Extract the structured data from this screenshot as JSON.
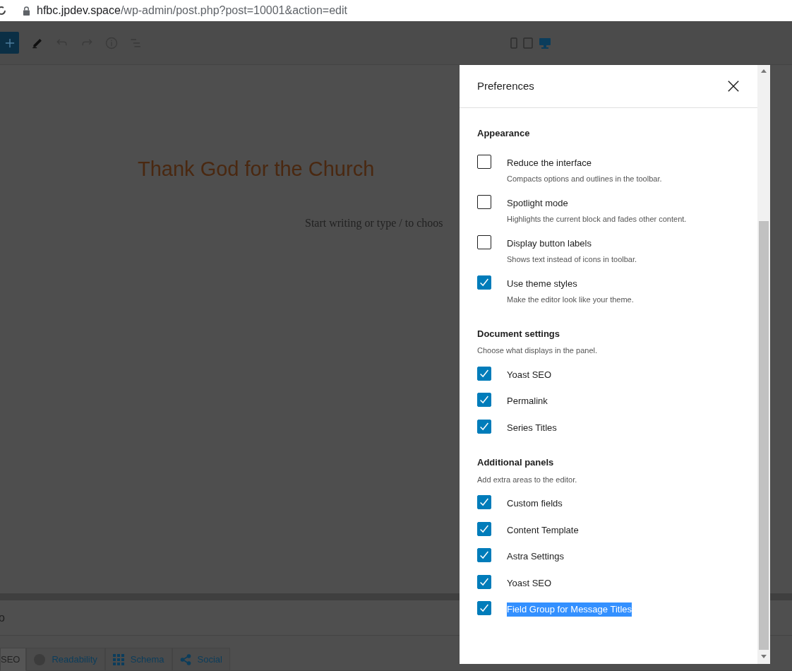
{
  "browser": {
    "url_host": "hfbc.jpdev.space",
    "url_path": "/wp-admin/post.php?post=10001&action=edit"
  },
  "device_previews": [
    {
      "kind": "mobile",
      "selected": false
    },
    {
      "kind": "tablet",
      "selected": false
    },
    {
      "kind": "desktop",
      "selected": true
    }
  ],
  "editor": {
    "title": "Thank God for the Church",
    "body_placeholder": "Start writing or type / to choos"
  },
  "yoast_panel": {
    "heading_fragment": "o",
    "tabs": [
      {
        "kind": "seo",
        "label": "SEO",
        "selected": true
      },
      {
        "kind": "readability",
        "label": "Readability",
        "selected": false
      },
      {
        "kind": "schema",
        "label": "Schema",
        "selected": false
      },
      {
        "kind": "social",
        "label": "Social",
        "selected": false
      }
    ]
  },
  "preferences": {
    "title": "Preferences",
    "sections": [
      {
        "heading": "Appearance",
        "options": [
          {
            "label": "Reduce the interface",
            "description": "Compacts options and outlines in the toolbar.",
            "checked": false
          },
          {
            "label": "Spotlight mode",
            "description": "Highlights the current block and fades other content.",
            "checked": false
          },
          {
            "label": "Display button labels",
            "description": "Shows text instead of icons in toolbar.",
            "checked": false
          },
          {
            "label": "Use theme styles",
            "description": "Make the editor look like your theme.",
            "checked": true
          }
        ]
      },
      {
        "heading": "Document settings",
        "description": "Choose what displays in the panel.",
        "options": [
          {
            "label": "Yoast SEO",
            "checked": true
          },
          {
            "label": "Permalink",
            "checked": true
          },
          {
            "label": "Series Titles",
            "checked": true
          }
        ]
      },
      {
        "heading": "Additional panels",
        "description": "Add extra areas to the editor.",
        "options": [
          {
            "label": "Custom fields",
            "checked": true
          },
          {
            "label": "Content Template",
            "checked": true
          },
          {
            "label": "Astra Settings",
            "checked": true
          },
          {
            "label": "Yoast SEO",
            "checked": true
          },
          {
            "label": "Field Group for Message Titles",
            "checked": true,
            "highlighted": true
          }
        ]
      }
    ]
  }
}
